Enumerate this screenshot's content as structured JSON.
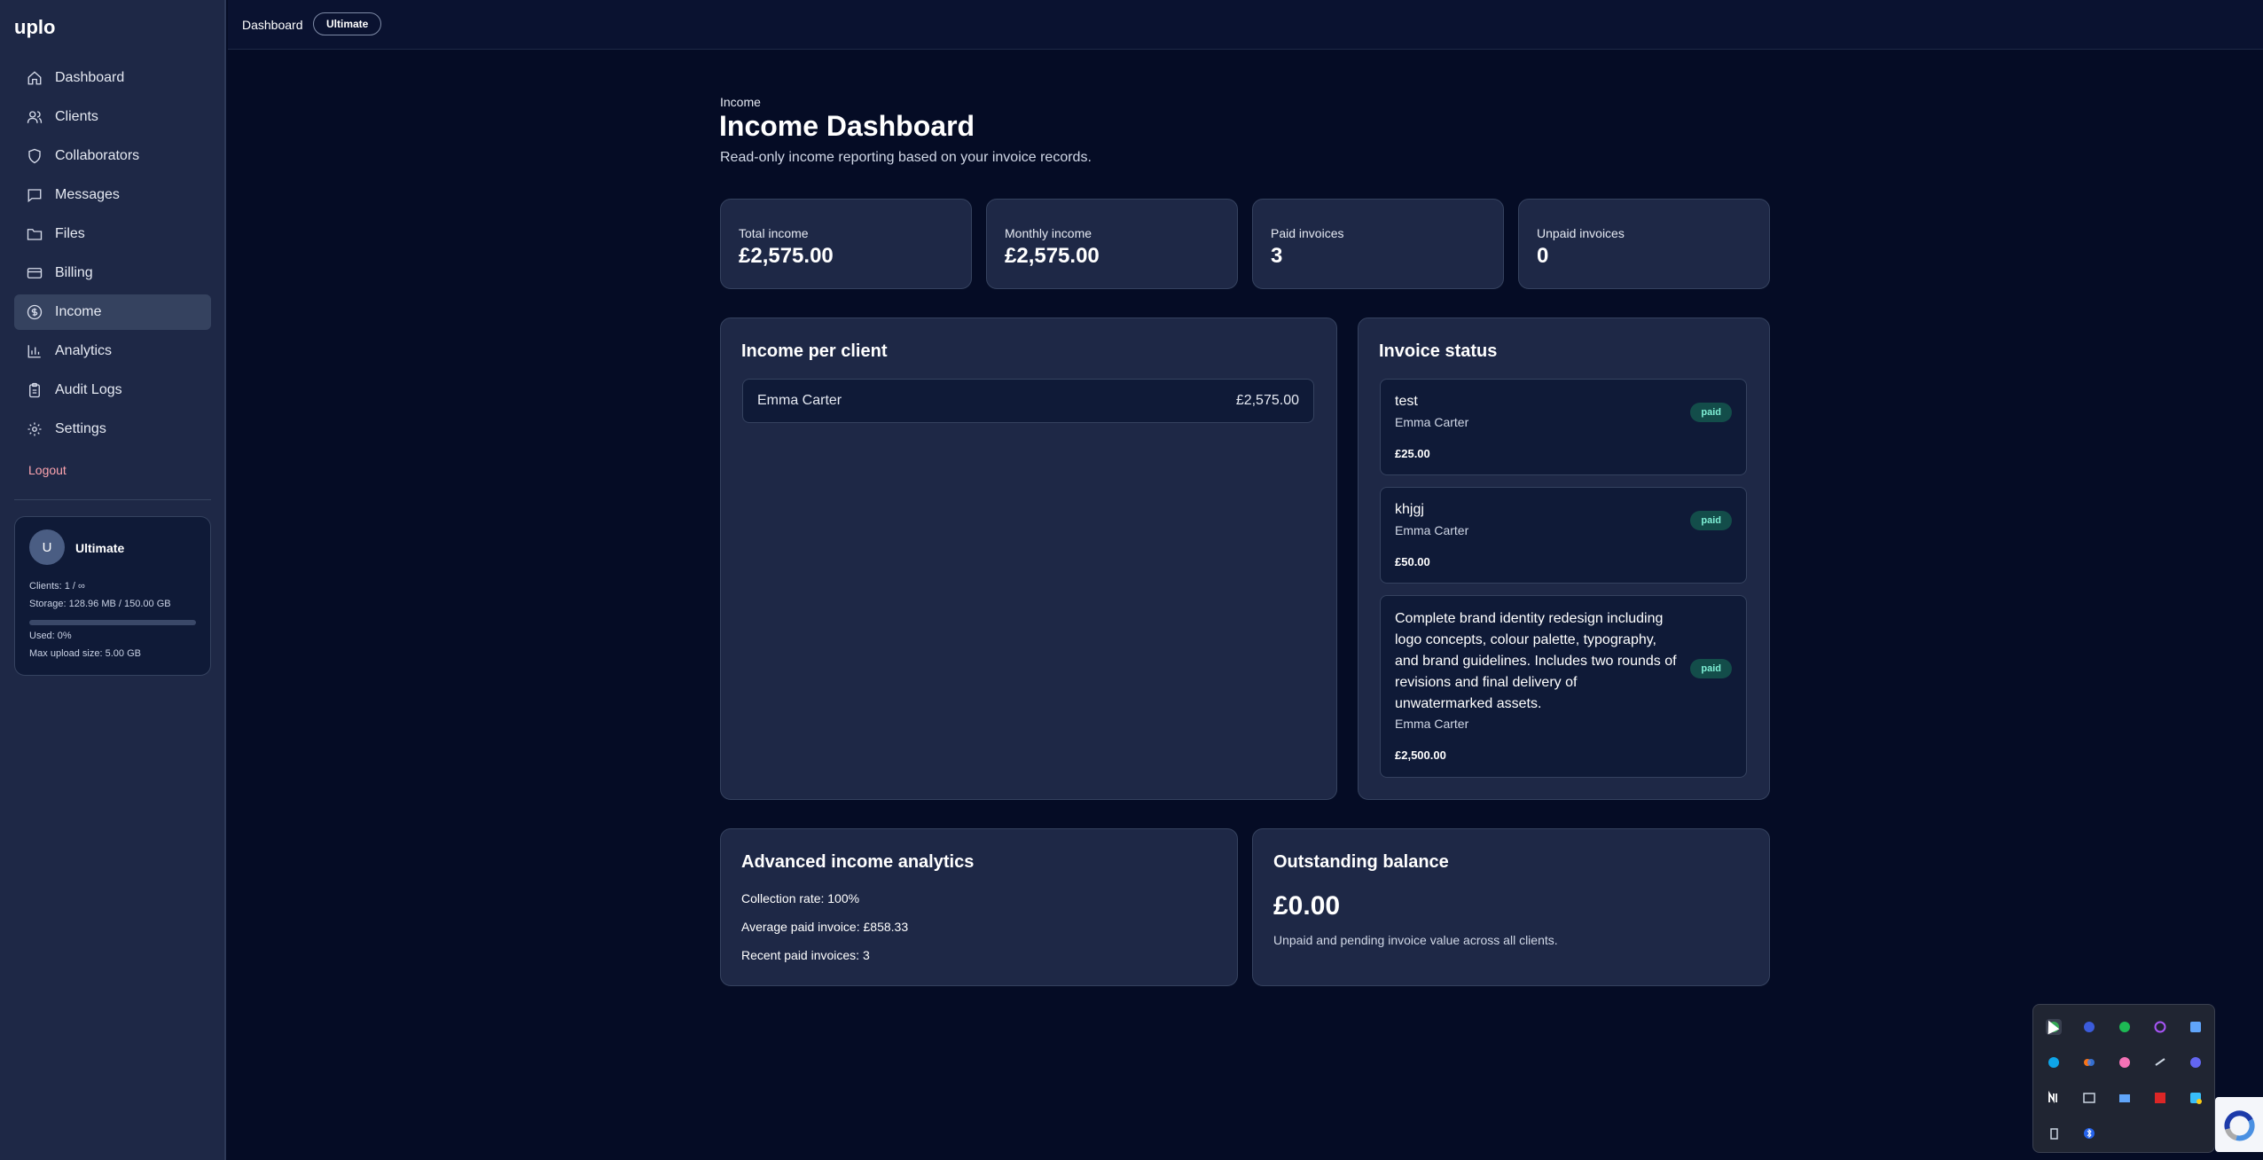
{
  "app": {
    "brand": "uplo"
  },
  "sidebar": {
    "items": [
      {
        "label": "Dashboard",
        "icon": "home-icon"
      },
      {
        "label": "Clients",
        "icon": "users-icon"
      },
      {
        "label": "Collaborators",
        "icon": "shield-icon"
      },
      {
        "label": "Messages",
        "icon": "message-icon"
      },
      {
        "label": "Files",
        "icon": "folder-icon"
      },
      {
        "label": "Billing",
        "icon": "credit-card-icon"
      },
      {
        "label": "Income",
        "icon": "dollar-circle-icon",
        "active": true
      },
      {
        "label": "Analytics",
        "icon": "bar-chart-icon"
      },
      {
        "label": "Audit Logs",
        "icon": "clipboard-icon"
      },
      {
        "label": "Settings",
        "icon": "gear-icon"
      }
    ],
    "logout": "Logout",
    "plan": {
      "avatar": "U",
      "name": "Ultimate",
      "clients": "Clients: 1 / ∞",
      "storage": "Storage: 128.96 MB / 150.00 GB",
      "used": "Used: 0%",
      "used_fraction": 0.0,
      "max_upload": "Max upload size: 5.00 GB"
    }
  },
  "topbar": {
    "breadcrumb": "Dashboard",
    "plan_badge": "Ultimate"
  },
  "page": {
    "eyebrow": "Income",
    "title": "Income Dashboard",
    "subtitle": "Read-only income reporting based on your invoice records."
  },
  "stats": [
    {
      "label": "Total income",
      "value": "£2,575.00"
    },
    {
      "label": "Monthly income",
      "value": "£2,575.00"
    },
    {
      "label": "Paid invoices",
      "value": "3"
    },
    {
      "label": "Unpaid invoices",
      "value": "0"
    }
  ],
  "income_per_client": {
    "title": "Income per client",
    "rows": [
      {
        "client": "Emma Carter",
        "amount": "£2,575.00"
      }
    ]
  },
  "invoice_status": {
    "title": "Invoice status",
    "invoices": [
      {
        "title": "test",
        "client": "Emma Carter",
        "amount": "£25.00",
        "status": "paid"
      },
      {
        "title": "khjgj",
        "client": "Emma Carter",
        "amount": "£50.00",
        "status": "paid"
      },
      {
        "title": "Complete brand identity redesign including logo concepts, colour palette, typography, and brand guidelines. Includes two rounds of revisions and final delivery of unwatermarked assets.",
        "client": "Emma Carter",
        "amount": "£2,500.00",
        "status": "paid"
      }
    ]
  },
  "analytics": {
    "title": "Advanced income analytics",
    "collection_rate": "Collection rate: 100%",
    "average_paid": "Average paid invoice: £858.33",
    "recent_paid": "Recent paid invoices: 3"
  },
  "balance": {
    "title": "Outstanding balance",
    "value": "£0.00",
    "note": "Unpaid and pending invoice value across all clients."
  },
  "colors": {
    "background": "#050c25",
    "card": "#1e2846",
    "paid_badge": "#134d4a",
    "paid_text": "#7ff0d6",
    "logout": "#fda4af"
  }
}
